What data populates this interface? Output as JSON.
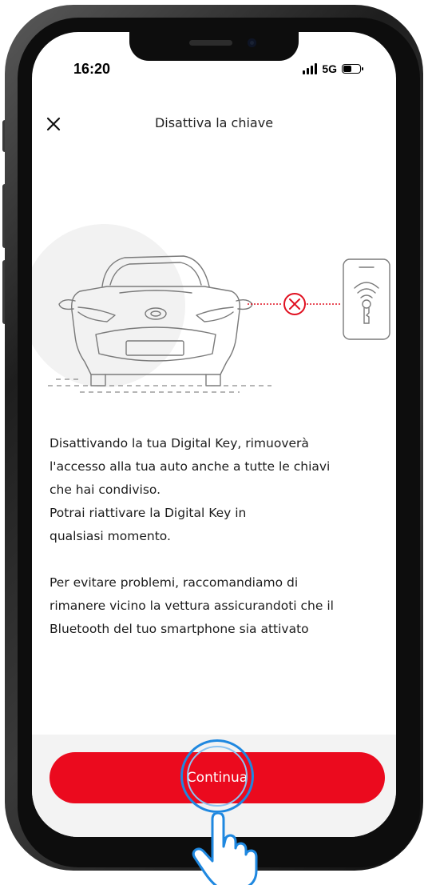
{
  "status_bar": {
    "time": "16:20",
    "network": "5G",
    "battery_level": 0.55
  },
  "header": {
    "title": "Disattiva la chiave",
    "close_icon": "close-icon"
  },
  "illustration": {
    "icons": [
      "car-icon",
      "error-circle-icon",
      "phone-key-icon"
    ]
  },
  "description": {
    "paragraph1": [
      "Disattivando la tua Digital Key, rimuoverà",
      "l'accesso alla tua auto anche a tutte le chiavi",
      "che hai condiviso.",
      "Potrai riattivare la Digital Key in",
      "qualsiasi momento."
    ],
    "paragraph2": [
      "Per evitare problemi, raccomandiamo di",
      "rimanere vicino la vettura assicurandoti che il",
      "Bluetooth del tuo smartphone sia attivato"
    ]
  },
  "footer": {
    "continue_label": "Continua"
  },
  "colors": {
    "accent": "#eb0a1e",
    "tap_indicator": "#1f88e0"
  }
}
